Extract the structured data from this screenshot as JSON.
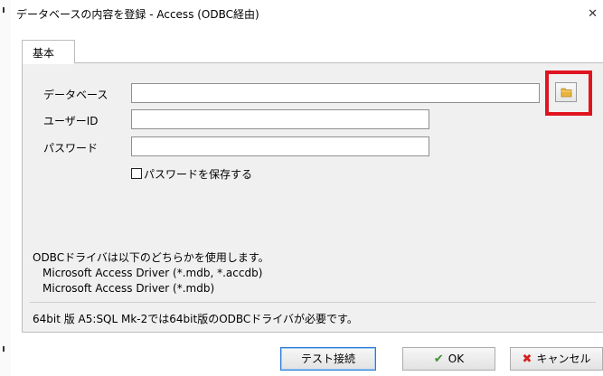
{
  "window": {
    "title": "データベースの内容を登録 - Access (ODBC経由)",
    "close_glyph": "✕"
  },
  "tabs": [
    {
      "label": "基本"
    }
  ],
  "form": {
    "database_label": "データベース",
    "database_value": "",
    "user_label": "ユーザーID",
    "user_value": "",
    "password_label": "パスワード",
    "password_value": "",
    "save_password_label": "パスワードを保存する",
    "save_password_checked": false
  },
  "notes": {
    "line1": "ODBCドライバは以下のどちらかを使用します。",
    "line2": "Microsoft Access Driver (*.mdb, *.accdb)",
    "line3": "Microsoft Access Driver (*.mdb)",
    "info": "64bit 版 A5:SQL Mk-2では64bit版のODBCドライバが必要です。"
  },
  "buttons": {
    "test_connection": "テスト接続",
    "ok": "OK",
    "cancel": "キャンセル",
    "ok_icon": "✔",
    "cancel_icon": "✖"
  },
  "colors": {
    "highlight": "#e0141e",
    "ok_icon": "#3c8f2f",
    "cancel_icon": "#d42020",
    "folder": "#e9b43c"
  },
  "icons": {
    "browse": "folder-icon",
    "ok": "check-icon",
    "cancel": "x-icon"
  }
}
